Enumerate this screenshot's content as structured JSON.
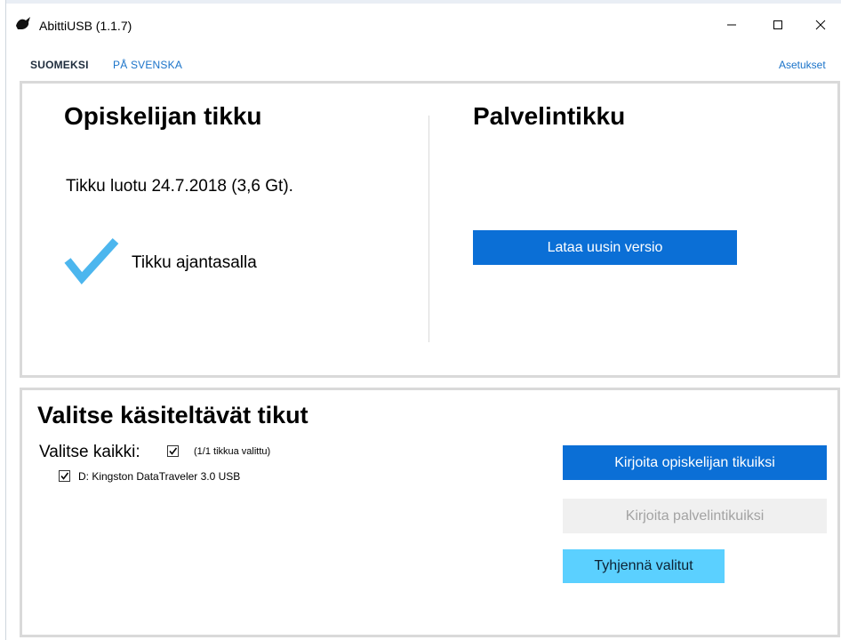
{
  "window": {
    "title": "AbittiUSB (1.1.7)",
    "icon": "abitti-bird-icon"
  },
  "nav": {
    "lang_fi": "SUOMEKSI",
    "lang_sv": "PÅ SVENSKA",
    "settings": "Asetukset"
  },
  "student_stick": {
    "heading": "Opiskelijan tikku",
    "created": "Tikku luotu 24.7.2018 (3,6 Gt).",
    "status": "Tikku ajantasalla",
    "status_icon": "checkmark-icon"
  },
  "server_stick": {
    "heading": "Palvelintikku",
    "download_button": "Lataa uusin versio"
  },
  "selection": {
    "heading": "Valitse käsiteltävät tikut",
    "select_all_label": "Valitse kaikki:",
    "select_all_checked": true,
    "selected_count": "(1/1 tikkua valittu)",
    "drives": [
      {
        "label": "D: Kingston DataTraveler 3.0 USB",
        "checked": true
      }
    ],
    "write_student_button": "Kirjoita opiskelijan tikuiksi",
    "write_server_button": "Kirjoita palvelintikuiksi",
    "clear_button": "Tyhjennä valitut"
  },
  "colors": {
    "primary": "#0b6fd6",
    "secondary": "#5bd0ff",
    "disabled_bg": "#f0f0f0",
    "disabled_text": "#a3a3a3",
    "link": "#1a73c9",
    "check": "#4cb6ee"
  }
}
